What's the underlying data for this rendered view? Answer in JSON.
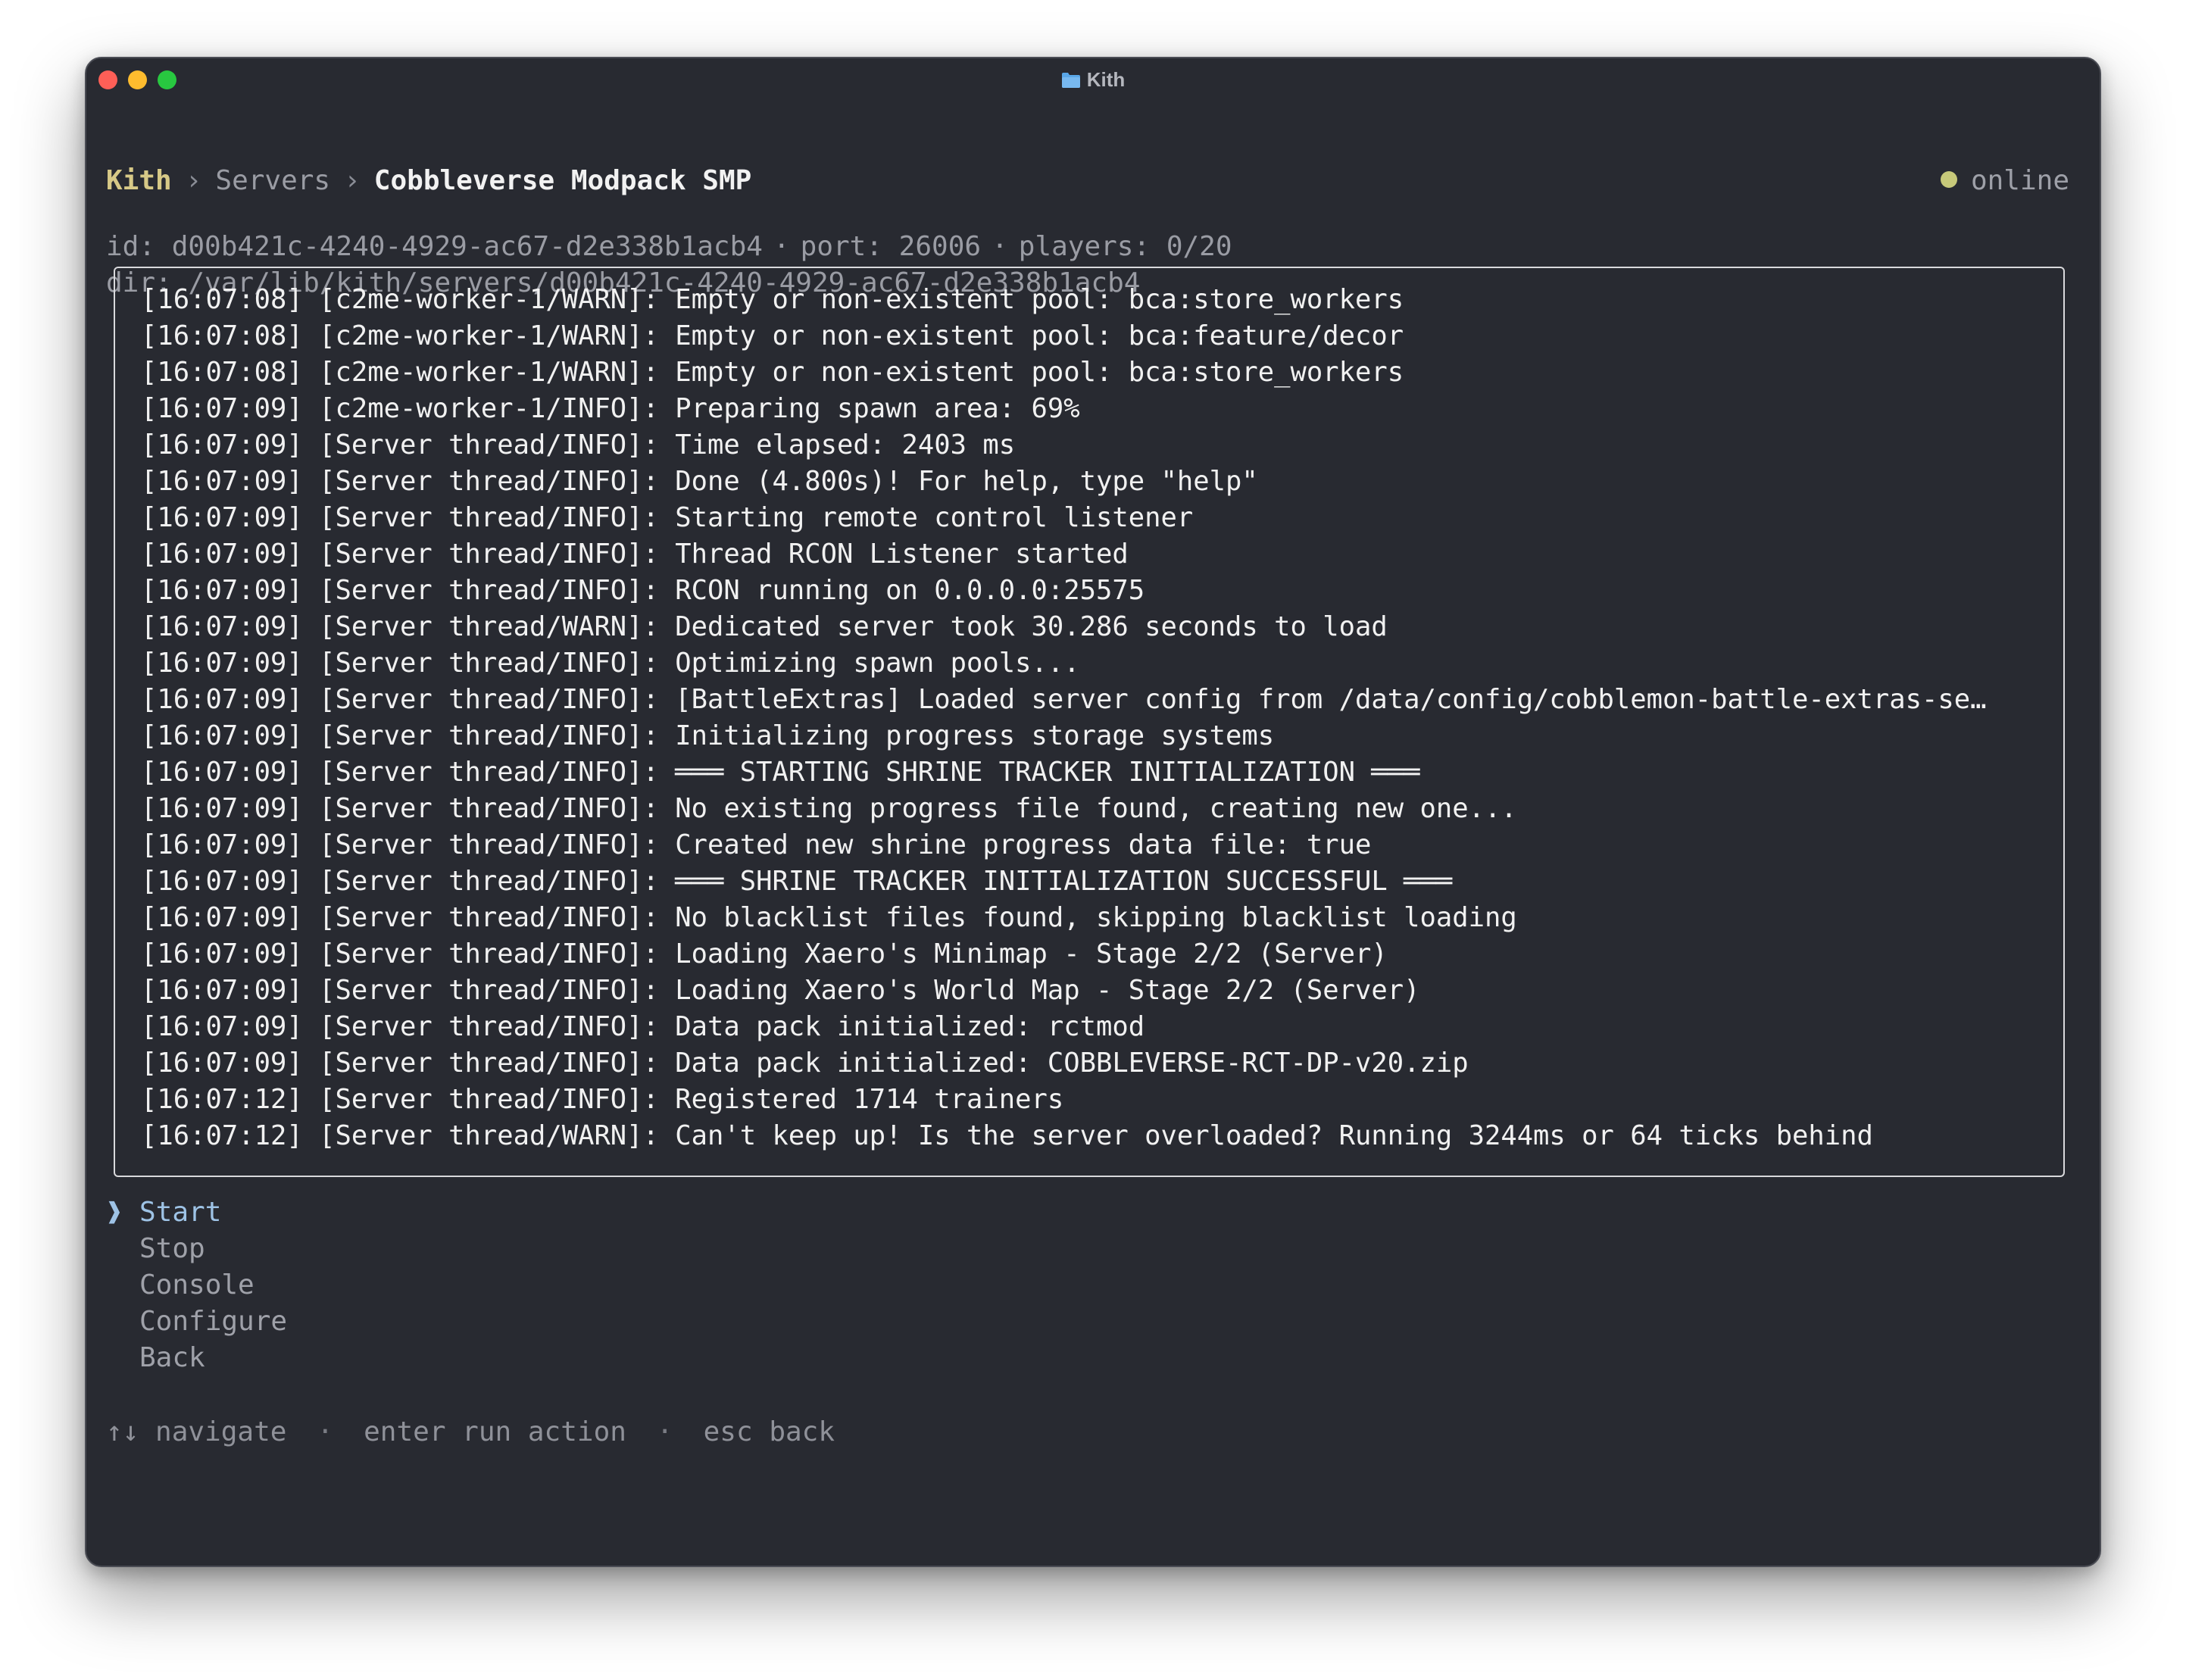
{
  "window": {
    "title": "Kith"
  },
  "breadcrumb": {
    "root": "Kith",
    "separator": "›",
    "section": "Servers",
    "current": "Cobbleverse Modpack SMP"
  },
  "status": {
    "label": "online",
    "color": "#c7c97a"
  },
  "meta": {
    "id": "id: d00b421c-4240-4929-ac67-d2e338b1acb4",
    "port": "port: 26006",
    "players": "players: 0/20",
    "separator": "·",
    "dir": "dir: /var/lib/kith/servers/d00b421c-4240-4929-ac67-d2e338b1acb4"
  },
  "log": [
    "[16:07:08] [c2me-worker-1/WARN]: Empty or non-existent pool: bca:store_workers",
    "[16:07:08] [c2me-worker-1/WARN]: Empty or non-existent pool: bca:feature/decor",
    "[16:07:08] [c2me-worker-1/WARN]: Empty or non-existent pool: bca:store_workers",
    "[16:07:09] [c2me-worker-1/INFO]: Preparing spawn area: 69%",
    "[16:07:09] [Server thread/INFO]: Time elapsed: 2403 ms",
    "[16:07:09] [Server thread/INFO]: Done (4.800s)! For help, type \"help\"",
    "[16:07:09] [Server thread/INFO]: Starting remote control listener",
    "[16:07:09] [Server thread/INFO]: Thread RCON Listener started",
    "[16:07:09] [Server thread/INFO]: RCON running on 0.0.0.0:25575",
    "[16:07:09] [Server thread/WARN]: Dedicated server took 30.286 seconds to load",
    "[16:07:09] [Server thread/INFO]: Optimizing spawn pools...",
    "[16:07:09] [Server thread/INFO]: [BattleExtras] Loaded server config from /data/config/cobblemon-battle-extras-se…",
    "[16:07:09] [Server thread/INFO]: Initializing progress storage systems",
    "[16:07:09] [Server thread/INFO]: ═══ STARTING SHRINE TRACKER INITIALIZATION ═══",
    "[16:07:09] [Server thread/INFO]: No existing progress file found, creating new one...",
    "[16:07:09] [Server thread/INFO]: Created new shrine progress data file: true",
    "[16:07:09] [Server thread/INFO]: ═══ SHRINE TRACKER INITIALIZATION SUCCESSFUL ═══",
    "[16:07:09] [Server thread/INFO]: No blacklist files found, skipping blacklist loading",
    "[16:07:09] [Server thread/INFO]: Loading Xaero's Minimap - Stage 2/2 (Server)",
    "[16:07:09] [Server thread/INFO]: Loading Xaero's World Map - Stage 2/2 (Server)",
    "[16:07:09] [Server thread/INFO]: Data pack initialized: rctmod",
    "[16:07:09] [Server thread/INFO]: Data pack initialized: COBBLEVERSE-RCT-DP-v20.zip",
    "[16:07:12] [Server thread/INFO]: Registered 1714 trainers",
    "[16:07:12] [Server thread/WARN]: Can't keep up! Is the server overloaded? Running 3244ms or 64 ticks behind"
  ],
  "menu": {
    "cursor": "❱",
    "items": [
      {
        "label": "Start",
        "selected": true
      },
      {
        "label": "Stop",
        "selected": false
      },
      {
        "label": "Console",
        "selected": false
      },
      {
        "label": "Configure",
        "selected": false
      },
      {
        "label": "Back",
        "selected": false
      }
    ]
  },
  "help": {
    "separator": "·",
    "items": [
      {
        "key": "↑↓",
        "desc": "navigate"
      },
      {
        "key": "enter",
        "desc": "run action"
      },
      {
        "key": "esc",
        "desc": "back"
      }
    ]
  },
  "colors": {
    "background": "#282a31",
    "accent": "#9ec3e6",
    "brand": "#d7c987"
  }
}
